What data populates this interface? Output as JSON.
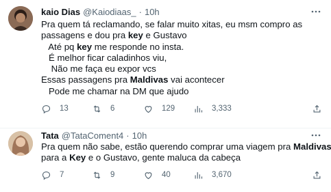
{
  "tweets": [
    {
      "name": "kaio Dias",
      "handle": "@Kaiodiaas_",
      "dot": "·",
      "time": "10h",
      "lines": [
        [
          {
            "t": "Pra quem tá reclamando, se falar muito xitas, eu msm compro as"
          }
        ],
        [
          {
            "t": "passagens e dou pra "
          },
          {
            "t": "key",
            "b": true
          },
          {
            "t": " e Gustavo"
          }
        ],
        [
          {
            "t": "   Até pq "
          },
          {
            "t": "key",
            "b": true
          },
          {
            "t": " me responde no insta."
          }
        ],
        [
          {
            "t": "   É melhor ficar caladinhos viu,"
          }
        ],
        [
          {
            "t": "    Não me faça eu expor vcs"
          }
        ],
        [
          {
            "t": "Essas passagens pra "
          },
          {
            "t": "Maldivas",
            "b": true
          },
          {
            "t": " vai acontecer"
          }
        ],
        [
          {
            "t": "   Pode me chamar na DM que ajudo"
          }
        ]
      ],
      "replies": "13",
      "retweets": "6",
      "likes": "129",
      "views": "3,333"
    },
    {
      "name": "Tata",
      "handle": "@TataComent4",
      "dot": "·",
      "time": "10h",
      "lines": [
        [
          {
            "t": "Pra quem não sabe, estão querendo comprar uma viagem pra "
          },
          {
            "t": "Maldivas",
            "b": true
          }
        ],
        [
          {
            "t": "para a "
          },
          {
            "t": "Key",
            "b": true
          },
          {
            "t": " e o Gustavo, gente maluca da cabeça"
          }
        ]
      ],
      "replies": "7",
      "retweets": "9",
      "likes": "40",
      "views": "3,670"
    }
  ],
  "icons": {
    "reply": "reply-icon",
    "retweet": "retweet-icon",
    "like": "heart-icon",
    "views": "views-icon",
    "share": "share-icon",
    "more": "more-icon"
  },
  "colors": {
    "text": "#0f1419",
    "secondary": "#536471",
    "divider": "#eff3f4"
  }
}
